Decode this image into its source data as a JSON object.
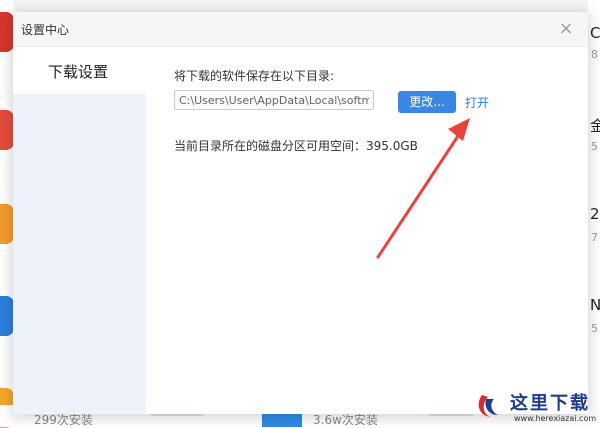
{
  "dialog": {
    "title": "设置中心",
    "close_glyph": "×"
  },
  "sidebar": {
    "items": [
      {
        "label": "下载设置",
        "selected": true
      }
    ]
  },
  "download_settings": {
    "save_label": "将下载的软件保存在以下目录:",
    "path_value": "C:\\Users\\User\\AppData\\Local\\softm...",
    "change_button": "更改...",
    "open_link": "打开",
    "free_space_label": "当前目录所在的磁盘分区可用空间：395.0GB"
  },
  "background": {
    "right_titles": [
      "C",
      "金",
      "2",
      "N"
    ],
    "right_subs": [
      "8",
      "5",
      "7",
      "5"
    ],
    "bottom_installs": [
      "299次安装",
      "3.6w次安装"
    ]
  },
  "watermark": {
    "text": "这里下载",
    "url": "www.herexiazai.com"
  },
  "colors": {
    "accent": "#3a87e3",
    "link": "#2a7fe0",
    "sidebar_bg": "#eef2fa",
    "arrow": "#e8433c"
  }
}
